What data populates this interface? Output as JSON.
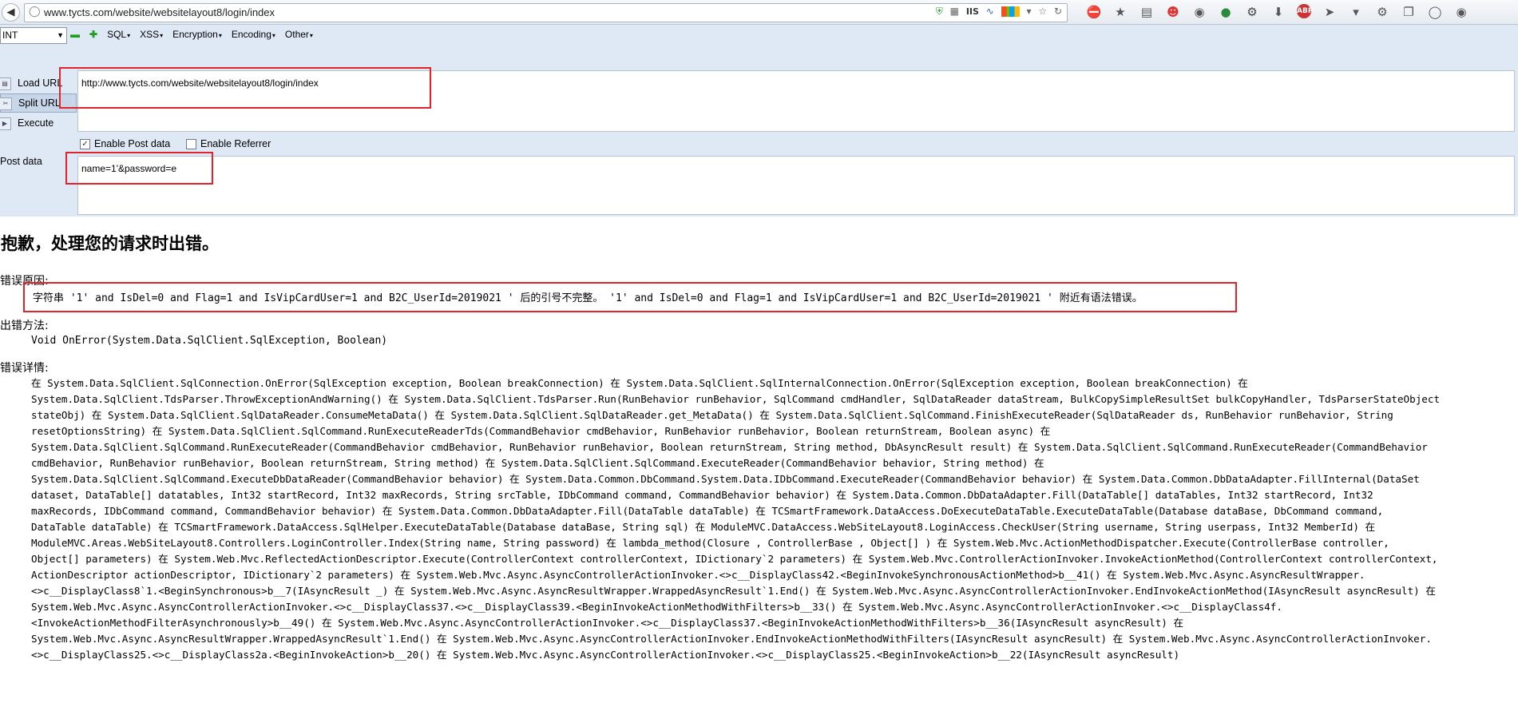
{
  "browser": {
    "back_glyph": "◀",
    "address_url": "www.tycts.com/website/websitelayout8/login/index",
    "address_badge": "IIS"
  },
  "hackbar": {
    "type_select": "INT",
    "menu": {
      "sql": "SQL",
      "xss": "XSS",
      "encryption": "Encryption",
      "encoding": "Encoding",
      "other": "Other"
    },
    "buttons": {
      "load_url": "Load URL",
      "split_url": "Split URL",
      "execute": "Execute"
    },
    "url_value": "http://www.tycts.com/website/websitelayout8/login/index",
    "enable_post_label": "Enable Post data",
    "enable_post_checked": true,
    "enable_referrer_label": "Enable Referrer",
    "enable_referrer_checked": false,
    "post_label": "Post data",
    "post_value": "name=1'&password=e"
  },
  "error_page": {
    "title": "抱歉，处理您的请求时出错。",
    "reason_label": "错误原因:",
    "reason_text": "字符串 '1' and IsDel=0 and Flag=1 and IsVipCardUser=1 and B2C_UserId=2019021 ' 后的引号不完整。 '1' and IsDel=0 and Flag=1 and IsVipCardUser=1 and B2C_UserId=2019021 ' 附近有语法错误。",
    "method_label": "出错方法:",
    "method_text": "Void OnError(System.Data.SqlClient.SqlException, Boolean)",
    "details_label": "错误详情:",
    "details_lines": [
      "在 System.Data.SqlClient.SqlConnection.OnError(SqlException exception, Boolean breakConnection) 在 System.Data.SqlClient.SqlInternalConnection.OnError(SqlException exception, Boolean breakConnection) 在",
      "System.Data.SqlClient.TdsParser.ThrowExceptionAndWarning() 在 System.Data.SqlClient.TdsParser.Run(RunBehavior runBehavior, SqlCommand cmdHandler, SqlDataReader dataStream, BulkCopySimpleResultSet bulkCopyHandler, TdsParserStateObject",
      "stateObj) 在 System.Data.SqlClient.SqlDataReader.ConsumeMetaData() 在 System.Data.SqlClient.SqlDataReader.get_MetaData() 在 System.Data.SqlClient.SqlCommand.FinishExecuteReader(SqlDataReader ds, RunBehavior runBehavior, String",
      "resetOptionsString) 在 System.Data.SqlClient.SqlCommand.RunExecuteReaderTds(CommandBehavior cmdBehavior, RunBehavior runBehavior, Boolean returnStream, Boolean async) 在",
      "System.Data.SqlClient.SqlCommand.RunExecuteReader(CommandBehavior cmdBehavior, RunBehavior runBehavior, Boolean returnStream, String method, DbAsyncResult result) 在 System.Data.SqlClient.SqlCommand.RunExecuteReader(CommandBehavior",
      "cmdBehavior, RunBehavior runBehavior, Boolean returnStream, String method) 在 System.Data.SqlClient.SqlCommand.ExecuteReader(CommandBehavior behavior, String method) 在",
      "System.Data.SqlClient.SqlCommand.ExecuteDbDataReader(CommandBehavior behavior) 在 System.Data.Common.DbCommand.System.Data.IDbCommand.ExecuteReader(CommandBehavior behavior) 在 System.Data.Common.DbDataAdapter.FillInternal(DataSet",
      "dataset, DataTable[] datatables, Int32 startRecord, Int32 maxRecords, String srcTable, IDbCommand command, CommandBehavior behavior) 在 System.Data.Common.DbDataAdapter.Fill(DataTable[] dataTables, Int32 startRecord, Int32",
      "maxRecords, IDbCommand command, CommandBehavior behavior) 在 System.Data.Common.DbDataAdapter.Fill(DataTable dataTable) 在 TCSmartFramework.DataAccess.DoExecuteDataTable.ExecuteDataTable(Database dataBase, DbCommand command,",
      "DataTable dataTable) 在 TCSmartFramework.DataAccess.SqlHelper.ExecuteDataTable(Database dataBase, String sql) 在 ModuleMVC.DataAccess.WebSiteLayout8.LoginAccess.CheckUser(String username, String userpass, Int32 MemberId) 在",
      "ModuleMVC.Areas.WebSiteLayout8.Controllers.LoginController.Index(String name, String password) 在 lambda_method(Closure , ControllerBase , Object[] ) 在 System.Web.Mvc.ActionMethodDispatcher.Execute(ControllerBase controller,",
      "Object[] parameters) 在 System.Web.Mvc.ReflectedActionDescriptor.Execute(ControllerContext controllerContext, IDictionary`2 parameters) 在 System.Web.Mvc.ControllerActionInvoker.InvokeActionMethod(ControllerContext controllerContext,",
      "ActionDescriptor actionDescriptor, IDictionary`2 parameters) 在 System.Web.Mvc.Async.AsyncControllerActionInvoker.<>c__DisplayClass42.<BeginInvokeSynchronousActionMethod>b__41() 在 System.Web.Mvc.Async.AsyncResultWrapper.",
      "<>c__DisplayClass8`1.<BeginSynchronous>b__7(IAsyncResult _) 在 System.Web.Mvc.Async.AsyncResultWrapper.WrappedAsyncResult`1.End() 在 System.Web.Mvc.Async.AsyncControllerActionInvoker.EndInvokeActionMethod(IAsyncResult asyncResult) 在",
      "System.Web.Mvc.Async.AsyncControllerActionInvoker.<>c__DisplayClass37.<>c__DisplayClass39.<BeginInvokeActionMethodWithFilters>b__33() 在 System.Web.Mvc.Async.AsyncControllerActionInvoker.<>c__DisplayClass4f.",
      "<InvokeActionMethodFilterAsynchronously>b__49() 在 System.Web.Mvc.Async.AsyncControllerActionInvoker.<>c__DisplayClass37.<BeginInvokeActionMethodWithFilters>b__36(IAsyncResult asyncResult) 在",
      "System.Web.Mvc.Async.AsyncResultWrapper.WrappedAsyncResult`1.End() 在 System.Web.Mvc.Async.AsyncControllerActionInvoker.EndInvokeActionMethodWithFilters(IAsyncResult asyncResult) 在 System.Web.Mvc.Async.AsyncControllerActionInvoker.",
      "<>c__DisplayClass25.<>c__DisplayClass2a.<BeginInvokeAction>b__20() 在 System.Web.Mvc.Async.AsyncControllerActionInvoker.<>c__DisplayClass25.<BeginInvokeAction>b__22(IAsyncResult asyncResult)"
    ]
  },
  "colors": {
    "highlight_box": "#e0242b",
    "hackbar_bg": "#dfe9f6"
  }
}
